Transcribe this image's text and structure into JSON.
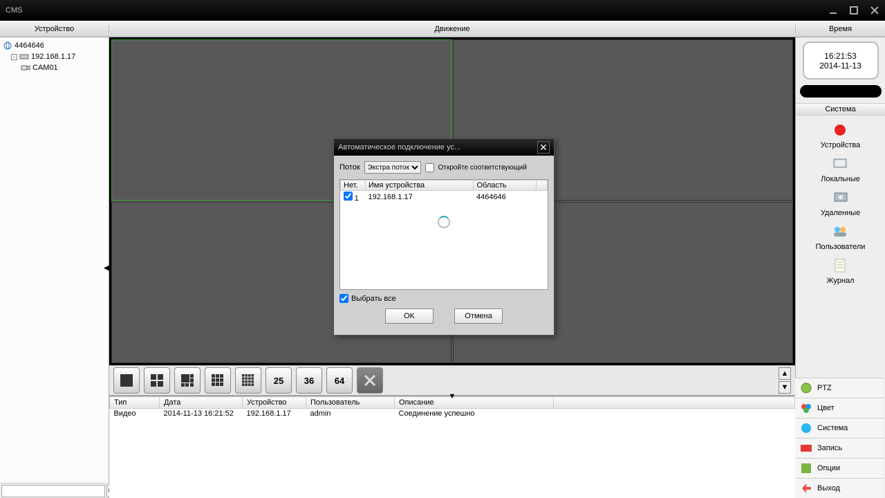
{
  "app_title": "CMS",
  "header": {
    "device": "Устройство",
    "motion": "Движение",
    "time": "Время"
  },
  "tree": {
    "root": "4464646",
    "device": "192.168.1.17",
    "camera": "CAM01"
  },
  "search": {
    "placeholder": ""
  },
  "clock": {
    "time": "16:21:53",
    "date": "2014-11-13"
  },
  "system_section": "Система",
  "services": {
    "devices": "Устройства",
    "local": "Локальные",
    "remote": "Удаленные",
    "users": "Пользователи",
    "journal": "Журнал"
  },
  "grid_buttons": {
    "b25": "25",
    "b36": "36",
    "b64": "64"
  },
  "right_tabs": {
    "ptz": "PTZ",
    "color": "Цвет",
    "system": "Система",
    "record": "Запись",
    "options": "Опции",
    "exit": "Выход"
  },
  "log": {
    "headers": {
      "type": "Тип",
      "date": "Дата",
      "device": "Устройство",
      "user": "Пользователь",
      "desc": "Описание"
    },
    "row": {
      "type": "Видео",
      "date": "2014-11-13 16:21:52",
      "device": "192.168.1.17",
      "user": "admin",
      "desc": "Соединение успешно"
    }
  },
  "dialog": {
    "title": "Автоматическое подключение ус...",
    "stream_label": "Поток",
    "stream_value": "Экстра поток",
    "open_corresponding": "Откройте соответствующий",
    "cols": {
      "no": "Нет.",
      "name": "Имя устройства",
      "area": "Область"
    },
    "row": {
      "num": "1",
      "name": "192.168.1.17",
      "area": "4464646"
    },
    "select_all": "Выбрать все",
    "ok": "OK",
    "cancel": "Отмена"
  }
}
